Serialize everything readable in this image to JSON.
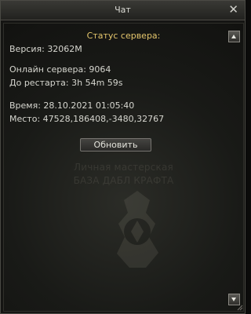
{
  "window": {
    "title": "Чат",
    "close_icon": "close-icon",
    "scroll_up_icon": "scroll-up-icon",
    "scroll_down_icon": "scroll-down-icon"
  },
  "server_status": {
    "heading": "Статус сервера:",
    "version": "Версия: 32062M",
    "online": "Онлайн сервера:  9064",
    "restart": "До рестарта: 3h 54m 59s",
    "time": "Время: 28.10.2021 01:05:40",
    "location": "Место: 47528,186408,-3480,32767",
    "refresh_button": "Обновить"
  },
  "background": {
    "watermark_line1": "Личная мастерская",
    "watermark_line2": "БАЗА ДАБЛ КРАФТА"
  },
  "colors": {
    "heading": "#e4c66c",
    "text": "#d6d6cf",
    "window_bg": "#151513"
  }
}
